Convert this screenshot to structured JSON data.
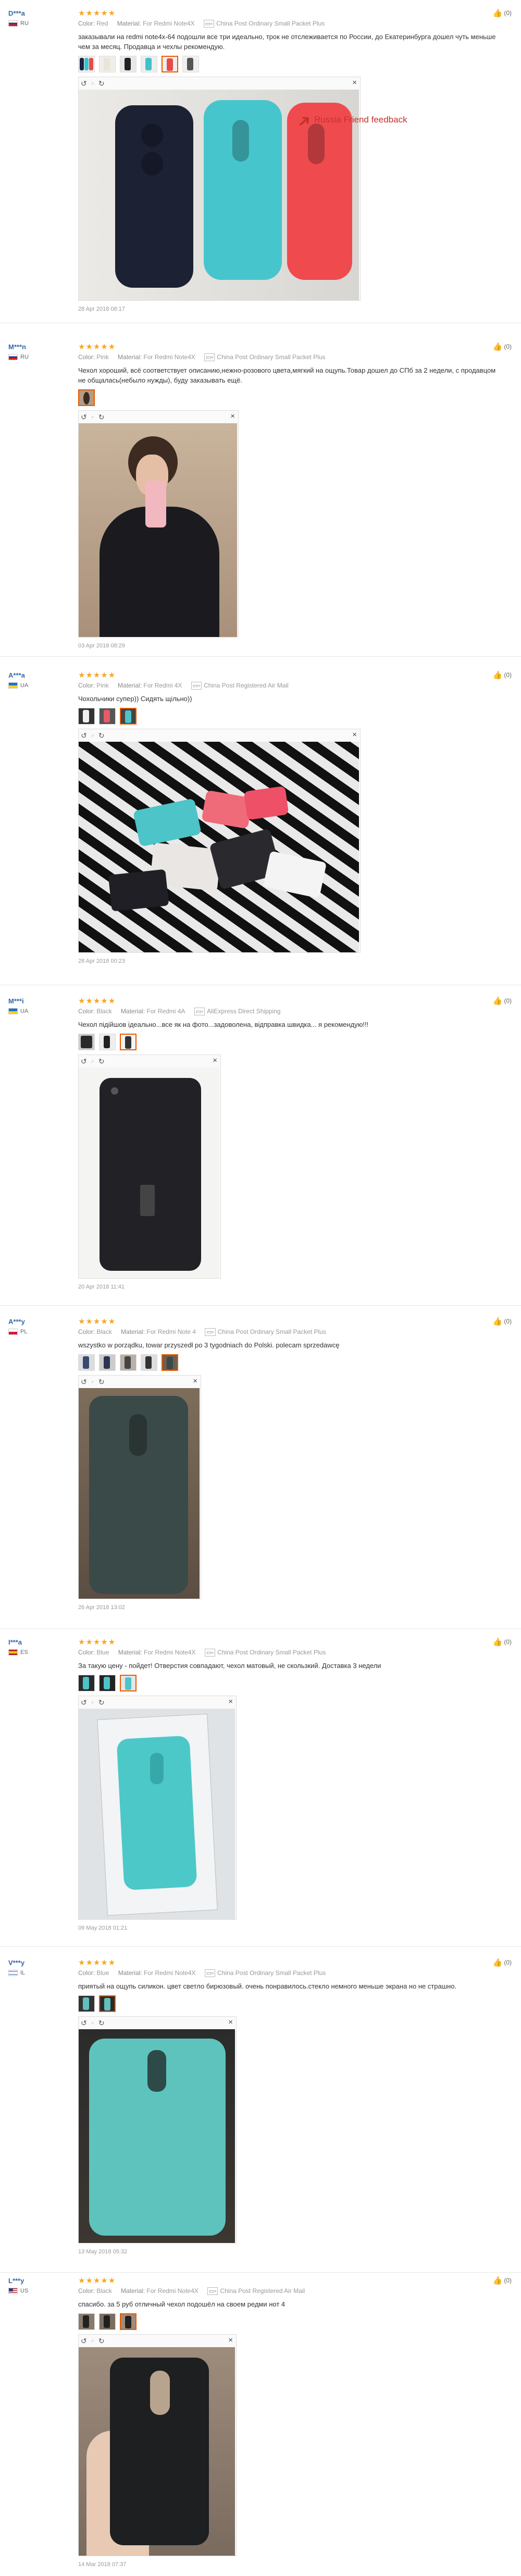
{
  "reviews": [
    {
      "user": "D***a",
      "country": "RU",
      "flag": "ru",
      "rating": "★★★★★",
      "color_label": "Color:",
      "color": "Red",
      "material_label": "Material:",
      "material": "For Redmi Note4X",
      "shipping": "China Post Ordinary Small Packet Plus",
      "text": "заказывали на redmi note4x-64 подошли все три идеально, трок не отслеживается по России, до Екатеринбурга дошел чуть меньше чем за месяц. Продавца и чехлы рекомендую.",
      "caption": "Russia Friend feedback",
      "date": "28 Apr 2018 08:17",
      "helpful": "(0)"
    },
    {
      "user": "M***n",
      "country": "RU",
      "flag": "ru",
      "rating": "★★★★★",
      "color_label": "Color:",
      "color": "Pink",
      "material_label": "Material:",
      "material": "For Redmi Note4X",
      "shipping": "China Post Ordinary Small Packet Plus",
      "text": "Чехол хороший, всё соответствует описанию,нежно-розового цвета,мягкий на ощупь.Товар дошел до СПб за 2 недели, с продавцом не общалась(небыло нужды), буду заказывать ещё.",
      "date": "03 Apr 2018 08:29",
      "helpful": "(0)"
    },
    {
      "user": "A***a",
      "country": "UA",
      "flag": "ua",
      "rating": "★★★★★",
      "color_label": "Color:",
      "color": "Pink",
      "material_label": "Material:",
      "material": "For Redmi 4X",
      "shipping": "China Post Registered Air Mail",
      "text": "Чохольчики супер)) Сидять щільно))",
      "date": "28 Apr 2018 00:23",
      "helpful": "(0)"
    },
    {
      "user": "M***i",
      "country": "UA",
      "flag": "ua",
      "rating": "★★★★★",
      "color_label": "Color:",
      "color": "Black",
      "material_label": "Material:",
      "material": "For Redmi 4A",
      "shipping": "AliExpress Direct Shipping",
      "text": "Чехол підійшов ідеально...все як на фото...задоволена, відправка швидка... я рекомендую!!!",
      "date": "20 Apr 2018 11:41",
      "helpful": "(0)"
    },
    {
      "user": "A***y",
      "country": "PL",
      "flag": "pl",
      "rating": "★★★★★",
      "color_label": "Color:",
      "color": "Black",
      "material_label": "Material:",
      "material": "For Redmi Note 4",
      "shipping": "China Post Ordinary Small Packet Plus",
      "text": "wszystko w porządku, towar przyszedł po 3 tygodniach do Polski. polecam sprzedawcę",
      "date": "26 Apr 2018 13:02",
      "helpful": "(0)"
    },
    {
      "user": "I***a",
      "country": "ES",
      "flag": "es",
      "rating": "★★★★★",
      "color_label": "Color:",
      "color": "Blue",
      "material_label": "Material:",
      "material": "For Redmi Note4X",
      "shipping": "China Post Ordinary Small Packet Plus",
      "text": "За такую цену - пойдет! Отверстия совпадают, чехол матовый, не скользкий. Доставка 3 недели",
      "date": "09 May 2018 01:21",
      "helpful": "(0)"
    },
    {
      "user": "V***y",
      "country": "IL",
      "flag": "il",
      "rating": "★★★★★",
      "color_label": "Color:",
      "color": "Blue",
      "material_label": "Material:",
      "material": "For Redmi Note4X",
      "shipping": "China Post Ordinary Small Packet Plus",
      "text": "приятый на ощупь силикон. цвет светло бирюзовый. очень понравилось.стекло немного меньше экрана но не страшно.",
      "date": "13 May 2018 05:32",
      "helpful": "(0)"
    },
    {
      "user": "L***y",
      "country": "US",
      "flag": "us",
      "rating": "★★★★★",
      "color_label": "Color:",
      "color": "Black",
      "material_label": "Material:",
      "material": "For Redmi Note4X",
      "shipping": "China Post Registered Air Mail",
      "text": "спасибо. за 5 руб отличный чехол подошёл на своем редми нот 4",
      "date": "14 Mar 2018 07:37",
      "helpful": "(0)"
    }
  ],
  "ui": {
    "zoom_label": "zoom",
    "rotate_label": "rotate"
  },
  "colors": {
    "star": "#f5a623",
    "username": "#3366aa",
    "caption": "#c9302c",
    "thumb_selected_border": "#e65c00"
  }
}
